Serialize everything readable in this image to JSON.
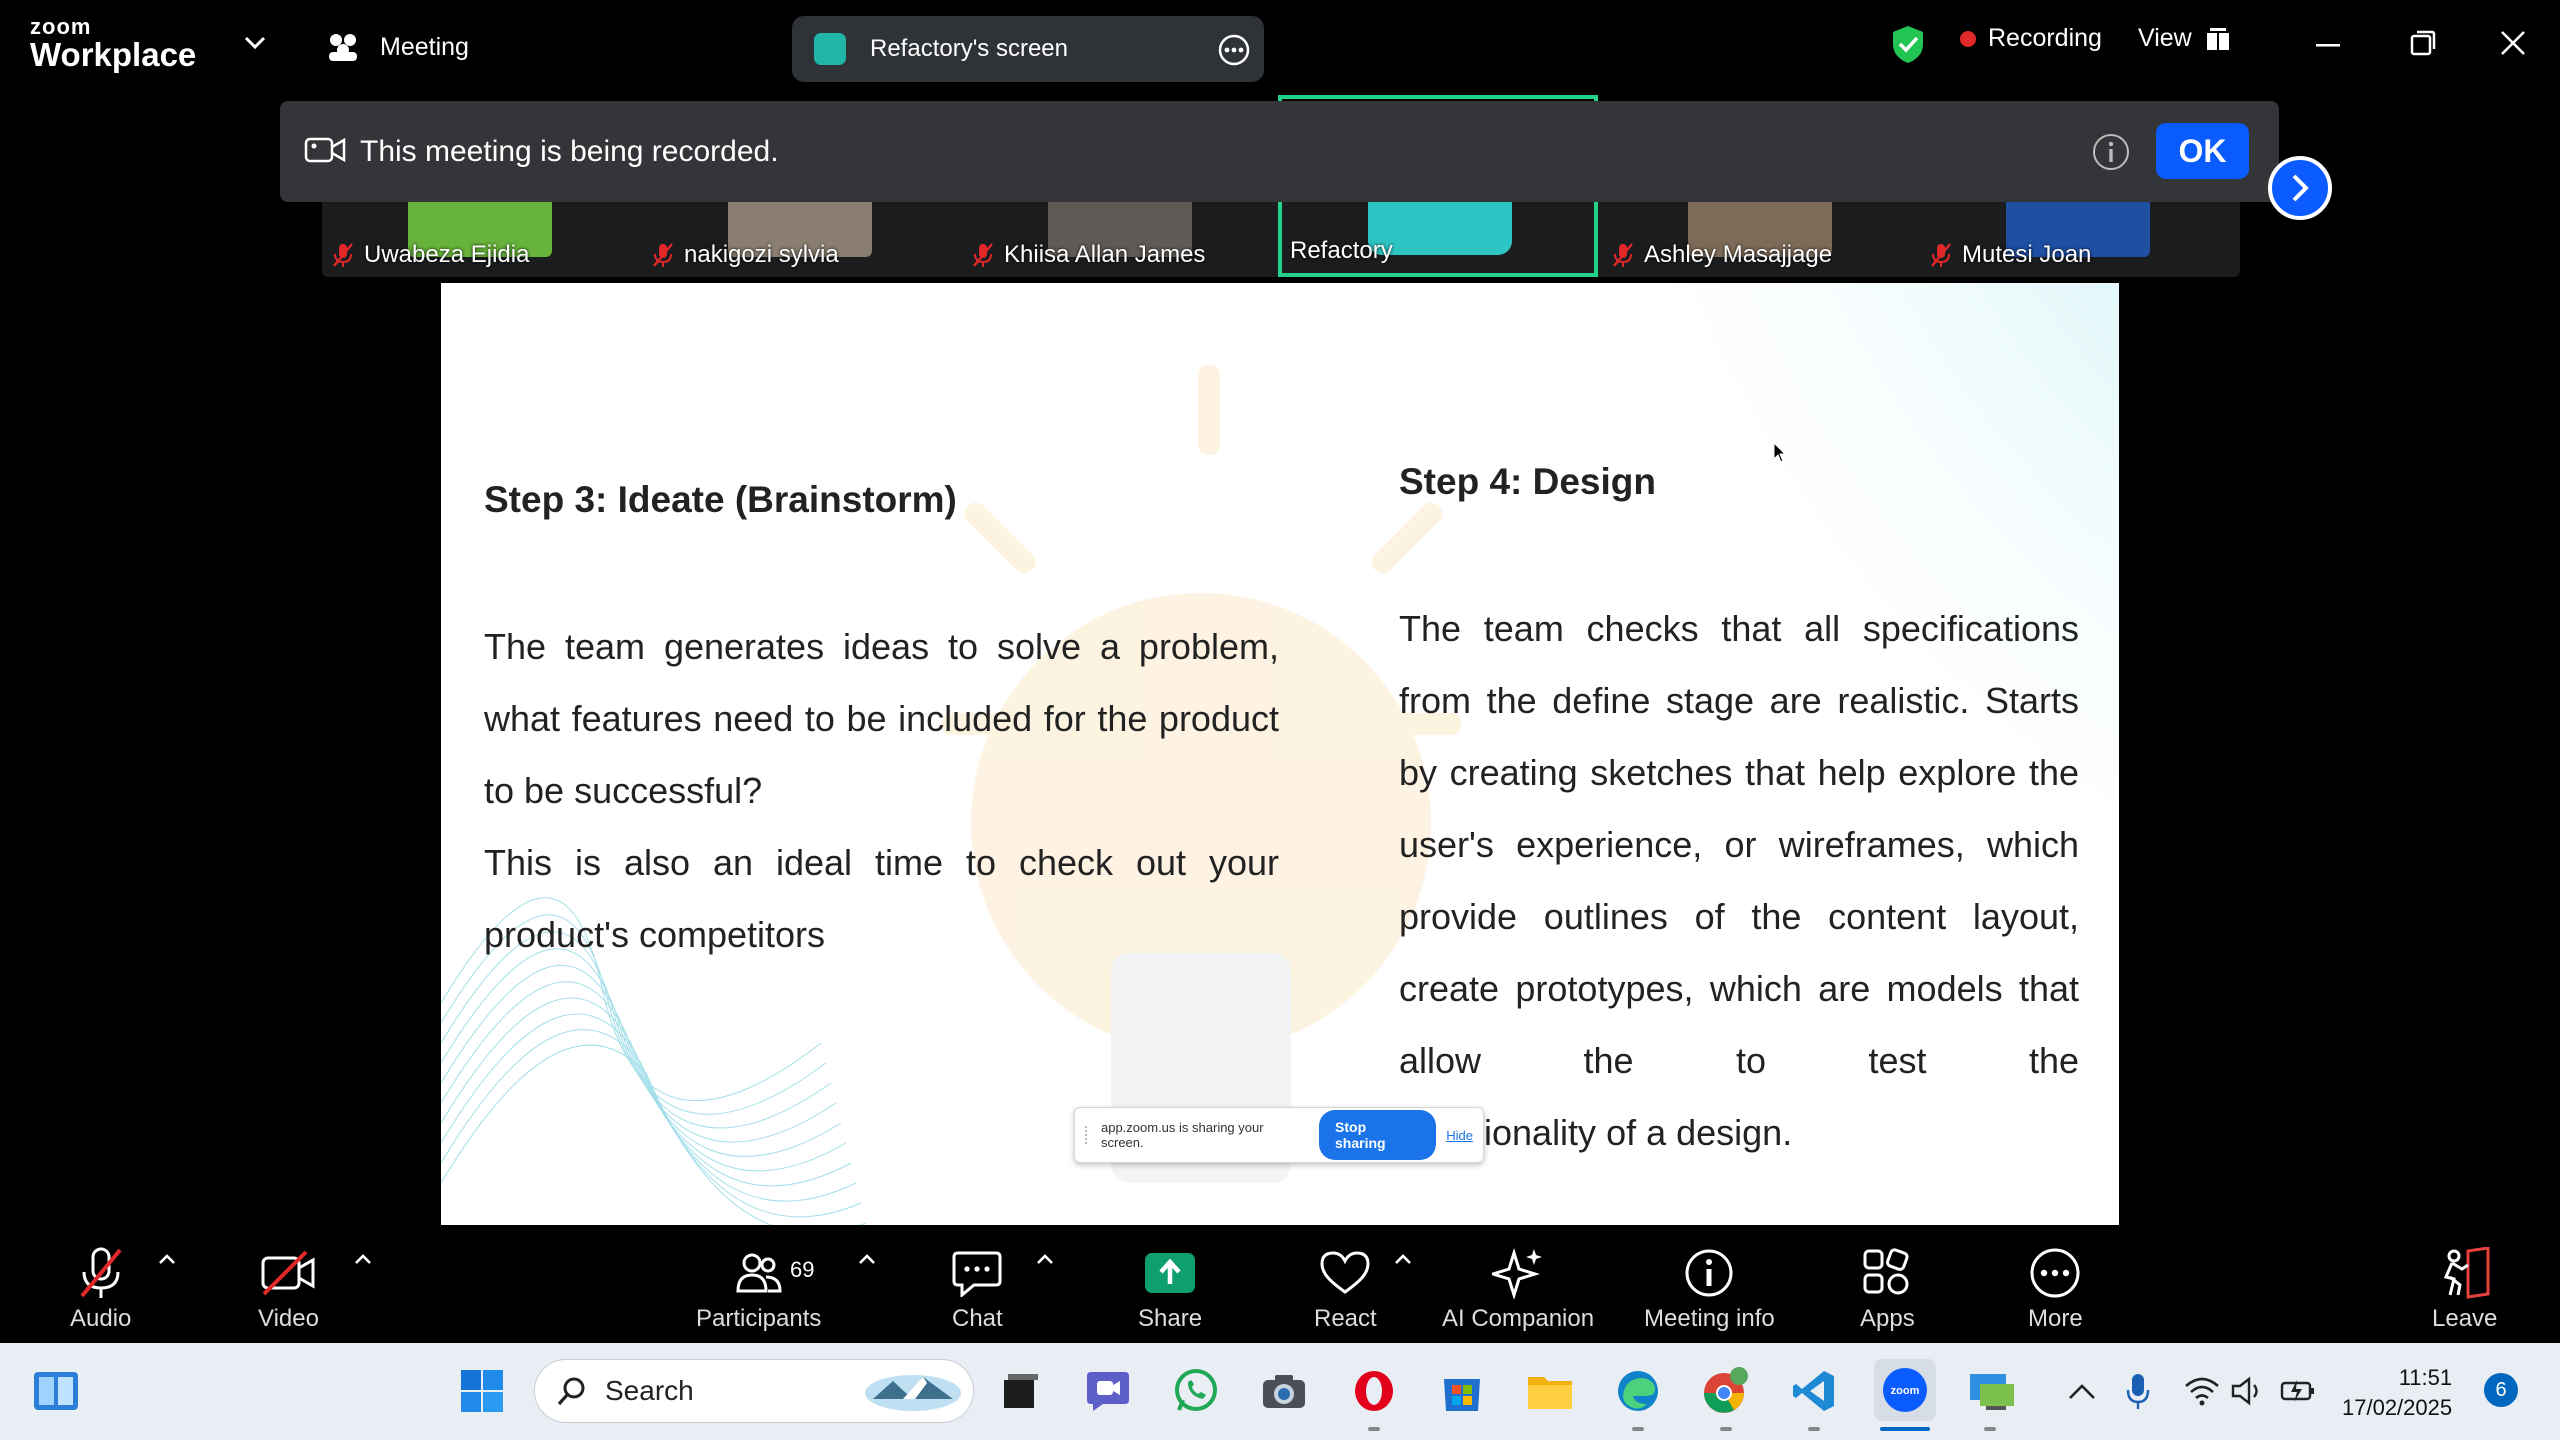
{
  "titlebar": {
    "brand_top": "zoom",
    "brand_bottom": "Workplace",
    "meeting_label": "Meeting",
    "screen_label": "Refactory's screen",
    "recording_label": "Recording",
    "view_label": "View"
  },
  "banner": {
    "message": "This meeting is being recorded.",
    "ok_label": "OK"
  },
  "participants": [
    {
      "name": "Uwabeza Ejidia",
      "muted": true
    },
    {
      "name": "nakigozi sylvia",
      "muted": true
    },
    {
      "name": "Khiisa Allan James",
      "muted": true
    },
    {
      "name": "Refactory",
      "muted": false
    },
    {
      "name": "Ashley Masajjage",
      "muted": true
    },
    {
      "name": "Mutesi Joan",
      "muted": true
    }
  ],
  "slide": {
    "left_heading": "Step 3: Ideate (Brainstorm)",
    "left_para1": "The team generates ideas to solve a problem, what features need to be included for the product to be successful?",
    "left_para2": "This is also an ideal time to check out your product's competitors",
    "right_heading": "Step 4: Design",
    "right_para": "The team checks that all specifications from the define stage are realistic. Starts by creating sketches that help explore the user's experience, or wireframes, which provide outlines of the content layout, create prototypes, which are models that allow the to test the",
    "right_para_tail": "ionality of a design."
  },
  "share_bar": {
    "text": "app.zoom.us is sharing your screen.",
    "stop_label": "Stop sharing",
    "hide_label": "Hide"
  },
  "toolbar": {
    "audio": "Audio",
    "video": "Video",
    "participants": "Participants",
    "participants_count": "69",
    "chat": "Chat",
    "share": "Share",
    "react": "React",
    "ai": "AI Companion",
    "meeting_info": "Meeting info",
    "apps": "Apps",
    "more": "More",
    "leave": "Leave"
  },
  "taskbar": {
    "search_placeholder": "Search",
    "time": "11:51",
    "date": "17/02/2025",
    "notifications": "6"
  },
  "colors": {
    "accent": "#0b5cff",
    "active_speaker": "#23d18b",
    "recording": "#e02828",
    "share_green": "#0e9f6e"
  }
}
